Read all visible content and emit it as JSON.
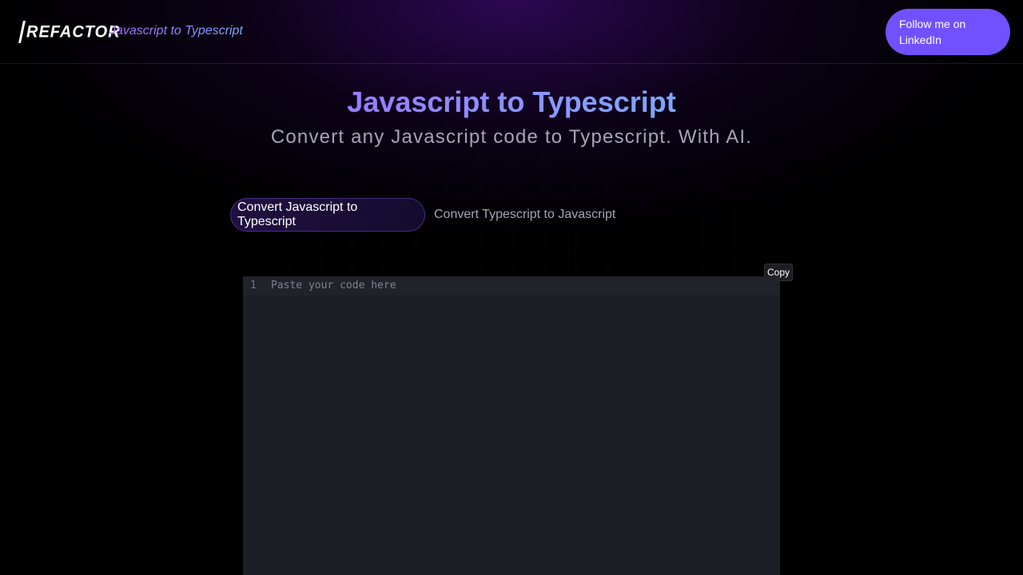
{
  "header": {
    "logo_text": "REFACTOR",
    "subtitle": "Javascript to Typescript",
    "linkedin_button": "Follow me on LinkedIn"
  },
  "hero": {
    "title": "Javascript to Typescript",
    "subtitle": "Convert any Javascript code to Typescript. With AI."
  },
  "tabs": [
    {
      "label": "Convert Javascript to Typescript",
      "active": true
    },
    {
      "label": "Convert Typescript to Javascript",
      "active": false
    }
  ],
  "editor": {
    "copy_label": "Copy",
    "line_number": "1",
    "placeholder": "Paste your code here"
  },
  "colors": {
    "accent": "#7151ff",
    "editor_background": "#1d1f27",
    "title_gradient_start": "#9b7bff",
    "title_gradient_end": "#7fa8ff"
  }
}
